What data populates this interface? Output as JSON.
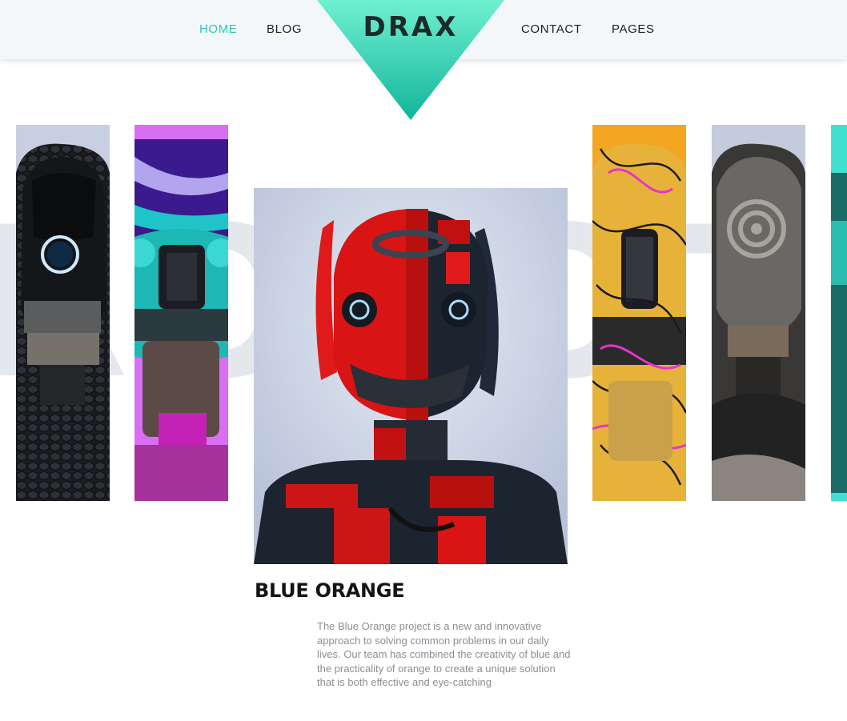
{
  "nav": {
    "items": [
      {
        "label": "HOME"
      },
      {
        "label": "BLOG"
      },
      {
        "label": "CONTACT"
      },
      {
        "label": "PAGES"
      }
    ],
    "logo": "DRAX"
  },
  "colors": {
    "accent": "#2ac9b4",
    "logo_teal_top": "#6ff0d0",
    "logo_teal_bottom": "#12b59b"
  },
  "hero": {
    "background_word": "ROBOT"
  },
  "gallery": {
    "cards": [
      {
        "name": "dark-hex-robot",
        "bg": "#c7cfe0"
      },
      {
        "name": "teal-marble-robot",
        "bg": "#d86ef2"
      },
      {
        "name": "graffiti-yellow-robot",
        "bg": "#f2a621"
      },
      {
        "name": "spiral-stone-robot",
        "bg": "#c3cbdc"
      },
      {
        "name": "teal-edge-robot",
        "bg": "#3fe0d0"
      }
    ]
  },
  "featured": {
    "title": "BLUE ORANGE",
    "description": "The Blue Orange project is a new and innovative approach to solving common problems in our daily lives. Our team has combined the creativity of blue and the practicality of orange to create a unique solution that is both effective and eye-catching"
  }
}
